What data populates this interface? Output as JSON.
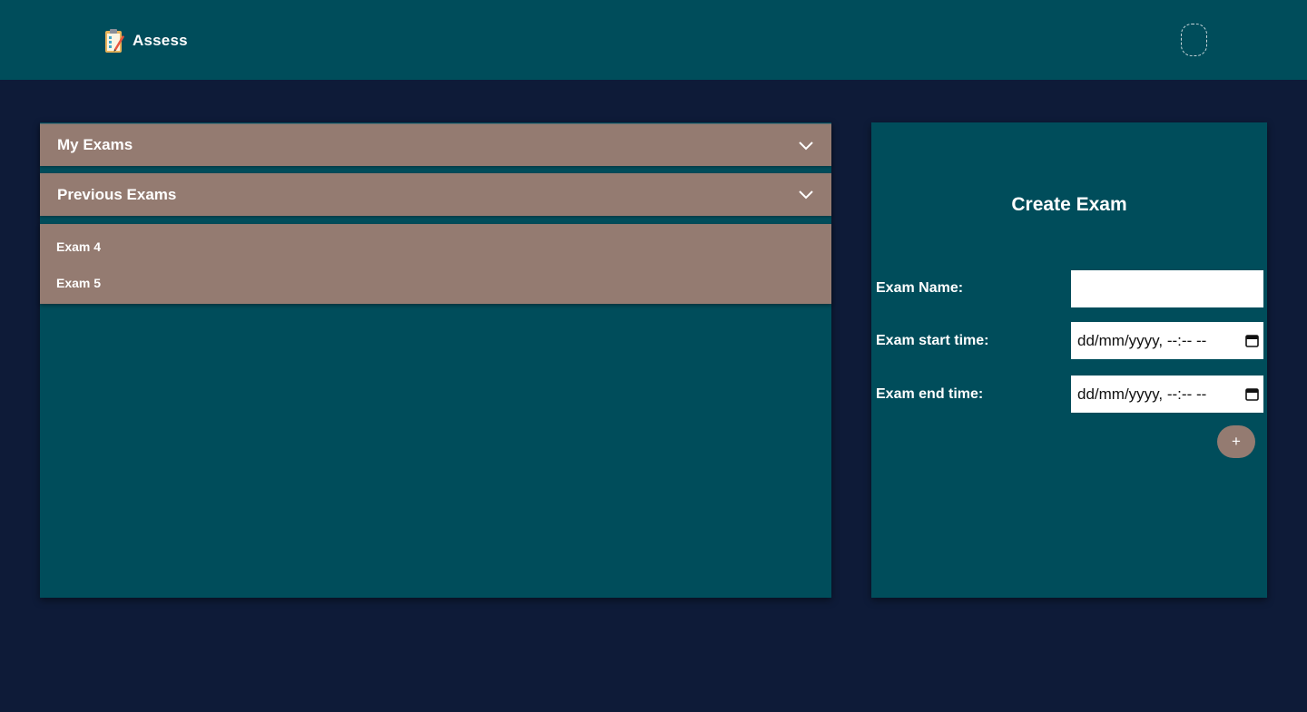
{
  "header": {
    "brand_name": "Assess",
    "brand_icon": "clipboard-pencil-icon",
    "avatar_icon": "user-avatar-placeholder"
  },
  "exams_panel": {
    "sections": [
      {
        "label": "My Exams",
        "icon": "chevron-down-icon"
      },
      {
        "label": "Previous Exams",
        "icon": "chevron-down-icon"
      }
    ],
    "previous_exams": [
      "Exam 4",
      "Exam 5"
    ]
  },
  "create_form": {
    "title": "Create Exam",
    "fields": [
      {
        "label": "Exam Name:",
        "value": ""
      },
      {
        "label": "Exam start time:",
        "value": "dd/mm/yyyy, --:-- --",
        "icon": "calendar-icon"
      },
      {
        "label": "Exam end time:",
        "value": "dd/mm/yyyy, --:-- --",
        "icon": "calendar-icon"
      }
    ],
    "add_label": "+"
  },
  "colors": {
    "background": "#0e1b38",
    "panel": "#004d5b",
    "accent": "#947b71",
    "text": "#ffffff"
  }
}
